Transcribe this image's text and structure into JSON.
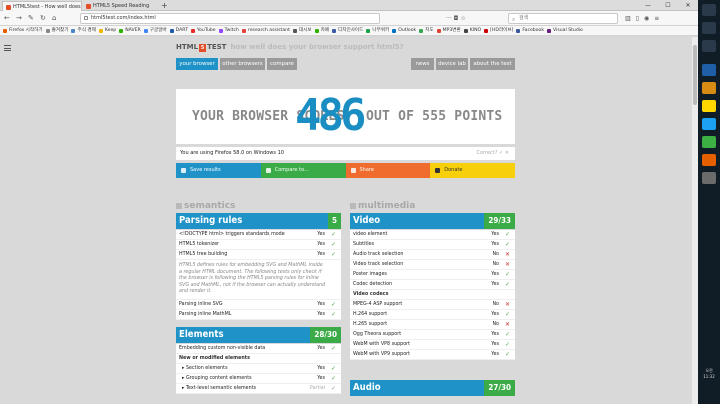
{
  "browser": {
    "tabs": [
      {
        "title": "HTML5test - How well does"
      },
      {
        "title": "HTML5 Speed Reading"
      }
    ],
    "url": "html5test.com/index.html",
    "search_placeholder": "검색",
    "bookmarks": [
      "Firefox 시작하기",
      "즐겨찾기",
      "주식 경제",
      "Keep",
      "NAVER",
      "구글알바",
      "DART",
      "YouTube",
      "Twitch",
      "research assistant",
      "대시보",
      "카페",
      "디지인사이드",
      "나무위키",
      "Outlook",
      "지도",
      "MP3변환",
      "KINO",
      "[HD라이브]",
      "Facebook",
      "Visual Studio"
    ]
  },
  "site": {
    "logo_pre": "HTML",
    "logo_badge": "5",
    "logo_post": "TEST",
    "tagline": "how well does your browser support html5?",
    "nav_left": [
      "your browser",
      "other browsers",
      "compare"
    ],
    "nav_right": [
      "news",
      "device lab",
      "about the test"
    ]
  },
  "score": {
    "prefix": "YOUR BROWSER SCORES",
    "value": "486",
    "suffix": "OUT OF 555 POINTS"
  },
  "using": {
    "text": "You are using Firefox 58.0 on Windows 10",
    "correct": "Correct?"
  },
  "actions": [
    {
      "label": "Save results",
      "color": "#1f93c7"
    },
    {
      "label": "Compare to...",
      "color": "#3bab47"
    },
    {
      "label": "Share",
      "color": "#f06b2e"
    },
    {
      "label": "Donate",
      "color": "#f7cf0a"
    }
  ],
  "sections": {
    "semantics": "semantics",
    "multimedia": "multimedia"
  },
  "parsing": {
    "title": "Parsing rules",
    "score": "5",
    "rows": [
      "<!DOCTYPE html> triggers standards mode",
      "HTML5 tokenizer",
      "HTML5 tree building"
    ],
    "note": "HTML5 defines rules for embedding SVG and MathML inside a regular HTML document. The following tests only check if the browser is following the HTML5 parsing rules for inline SVG and MathML, not if the browser can actually understand and render it.",
    "rows2": [
      "Parsing inline SVG",
      "Parsing inline MathML"
    ],
    "yes": "Yes"
  },
  "elements": {
    "title": "Elements",
    "score": "28/30",
    "row1": "Embedding custom non-visible data",
    "sub": "New or modified elements",
    "subrows": [
      "Section elements",
      "Grouping content elements",
      "Text-level semantic elements"
    ],
    "results": [
      "Yes",
      "Yes",
      "Yes",
      "Yes",
      "Partial"
    ]
  },
  "video": {
    "title": "Video",
    "score": "29/33",
    "rows": [
      [
        "video element",
        "Yes"
      ],
      [
        "Subtitles",
        "Yes"
      ],
      [
        "Audio track selection",
        "No"
      ],
      [
        "Video track selection",
        "No"
      ],
      [
        "Poster images",
        "Yes"
      ],
      [
        "Codec detection",
        "Yes"
      ]
    ],
    "sub": "Video codecs",
    "codecs": [
      [
        "MPEG-4 ASP support",
        "No"
      ],
      [
        "H.264 support",
        "Yes"
      ],
      [
        "H.265 support",
        "No"
      ],
      [
        "Ogg Theora support",
        "Yes"
      ],
      [
        "WebM with VP8 support",
        "Yes"
      ],
      [
        "WebM with VP9 support",
        "Yes"
      ]
    ]
  },
  "audio": {
    "title": "Audio",
    "score": "27/30"
  },
  "colors": {
    "blue": "#1a8ec2",
    "green": "#3bab47",
    "navtab_active": "#1f93c7",
    "navtab": "#9a9a9a"
  },
  "taskbar": {
    "time": "오전 11:32"
  }
}
